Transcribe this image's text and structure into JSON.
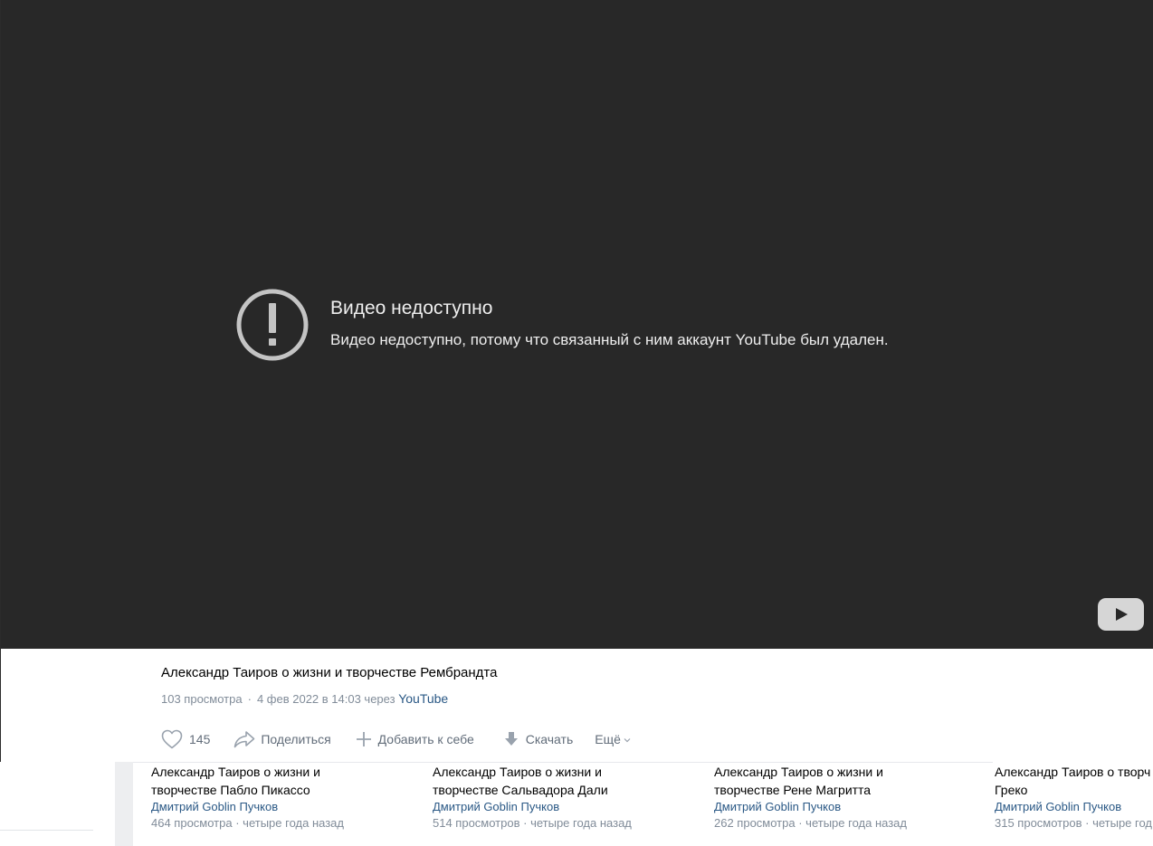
{
  "player": {
    "error_title": "Видео недоступно",
    "error_message": "Видео недоступно, потому что связанный с ним аккаунт YouTube был удален."
  },
  "video": {
    "title": "Александр Таиров о жизни и творчестве Рембрандта",
    "views": "103 просмотра",
    "date_prefix": "4 фев 2022 в 14:03 через",
    "source": "YouTube"
  },
  "actions": {
    "like_count": "145",
    "share_label": "Поделиться",
    "add_label": "Добавить к себе",
    "download_label": "Скачать",
    "more_label": "Ещё"
  },
  "related": [
    {
      "title_line1": "Александр Таиров о жизни и",
      "title_line2": "творчестве Пабло Пикассо",
      "author": "Дмитрий Goblin Пучков",
      "views": "464 просмотра",
      "age": "четыре года назад"
    },
    {
      "title_line1": "Александр Таиров о жизни и",
      "title_line2": "творчестве Сальвадора Дали",
      "author": "Дмитрий Goblin Пучков",
      "views": "514 просмотров",
      "age": "четыре года назад"
    },
    {
      "title_line1": "Александр Таиров о жизни и",
      "title_line2": "творчестве Рене Магритта",
      "author": "Дмитрий Goblin Пучков",
      "views": "262 просмотра",
      "age": "четыре года назад"
    },
    {
      "title_line1": "Александр Таиров о творч",
      "title_line2": "Греко",
      "author": "Дмитрий Goblin Пучков",
      "views": "315 просмотров",
      "age": "четыре год"
    }
  ],
  "icons": {
    "alert": "exclamation-circle-icon",
    "youtube": "youtube-play-icon",
    "like": "heart-icon",
    "share": "share-arrow-icon",
    "add": "plus-icon",
    "download": "download-arrow-icon",
    "more": "chevron-down-icon"
  },
  "colors": {
    "player_bg": "#282828",
    "link": "#2a5885",
    "muted": "#818c99",
    "action_text": "#626d7a"
  }
}
